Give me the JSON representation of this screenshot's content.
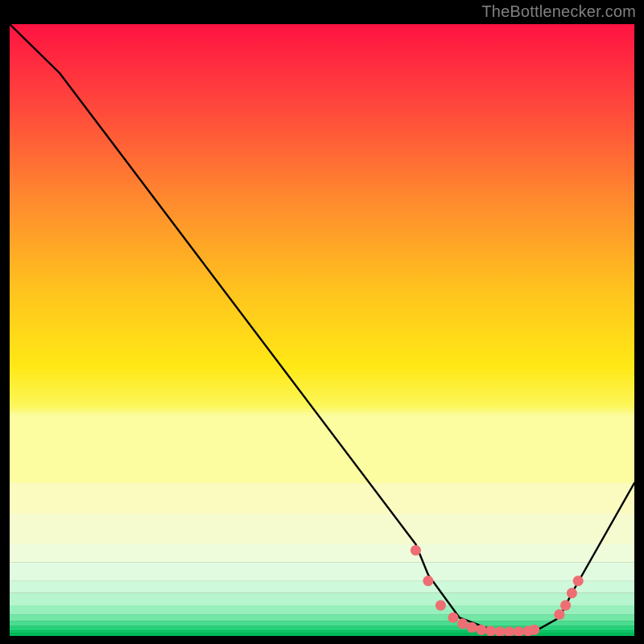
{
  "attribution": "TheBottlenecker.com",
  "chart_data": {
    "type": "line",
    "title": "",
    "xlabel": "",
    "ylabel": "",
    "xlim": [
      0,
      100
    ],
    "ylim": [
      0,
      100
    ],
    "background_gradient": {
      "top": "#ff1a40",
      "mid": "#ffe800",
      "bottom": "#00d060"
    },
    "band_edges_pct": [
      75,
      80,
      85,
      88,
      91,
      93,
      95,
      96.5,
      97.6,
      98.4,
      99.1,
      99.5,
      99.8,
      100
    ],
    "series": [
      {
        "name": "curve",
        "x": [
          0,
          8,
          65,
          67,
          72,
          78,
          84,
          88,
          90,
          100
        ],
        "y": [
          100,
          92,
          15,
          10,
          3,
          0.7,
          0.7,
          3,
          7,
          25
        ]
      }
    ],
    "markers": {
      "name": "valley-points",
      "color": "#ee6e73",
      "radius": 6.5,
      "x": [
        65,
        67,
        69,
        71,
        72.5,
        74,
        75.5,
        77,
        78.5,
        80,
        81.5,
        83,
        84,
        88,
        89,
        90,
        91
      ],
      "y": [
        14,
        9,
        5,
        3,
        2,
        1.4,
        1.0,
        0.8,
        0.7,
        0.7,
        0.7,
        0.8,
        1.0,
        3.5,
        5,
        7,
        9
      ]
    }
  }
}
